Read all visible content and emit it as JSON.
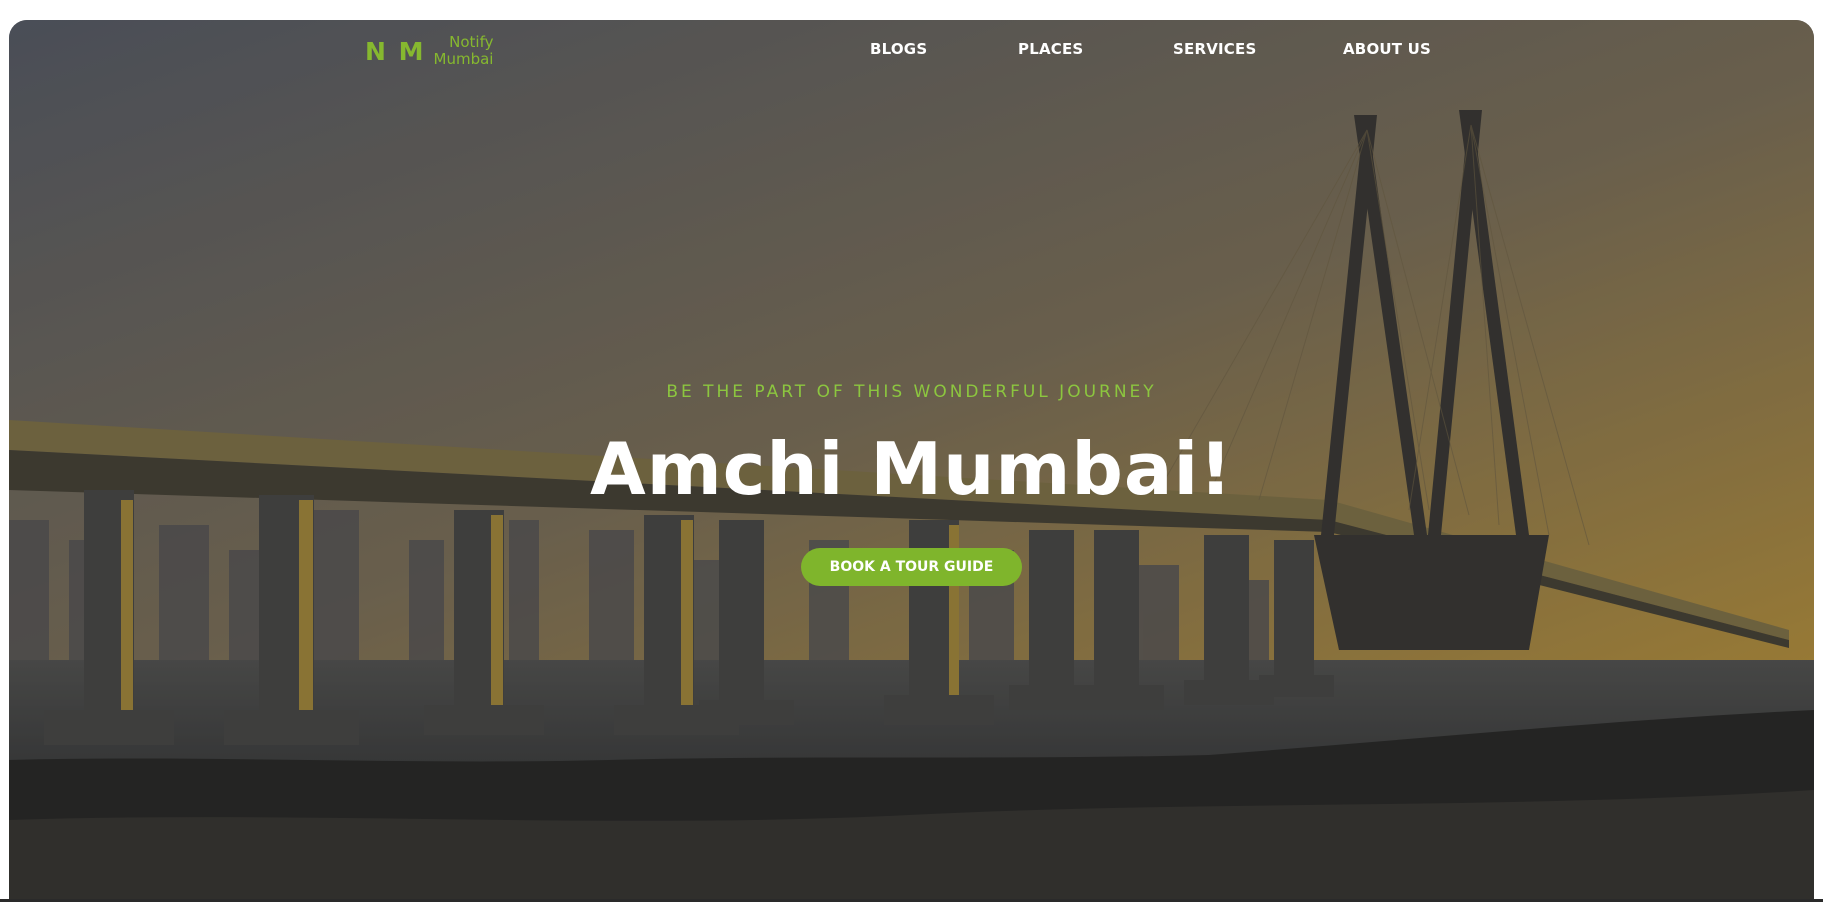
{
  "logo": {
    "mark": "N M",
    "line1": "Notify",
    "line2": "Mumbai"
  },
  "nav": {
    "blogs": "BLOGS",
    "places": "PLACES",
    "services": "SERVICES",
    "about": "ABOUT US"
  },
  "hero": {
    "tagline": "BE THE PART OF THIS WONDERFUL JOURNEY",
    "headline": "Amchi Mumbai!",
    "cta_label": "BOOK A TOUR GUIDE"
  },
  "colors": {
    "accent": "#7fb52c",
    "tagline": "#8cc63f",
    "text": "#ffffff"
  }
}
